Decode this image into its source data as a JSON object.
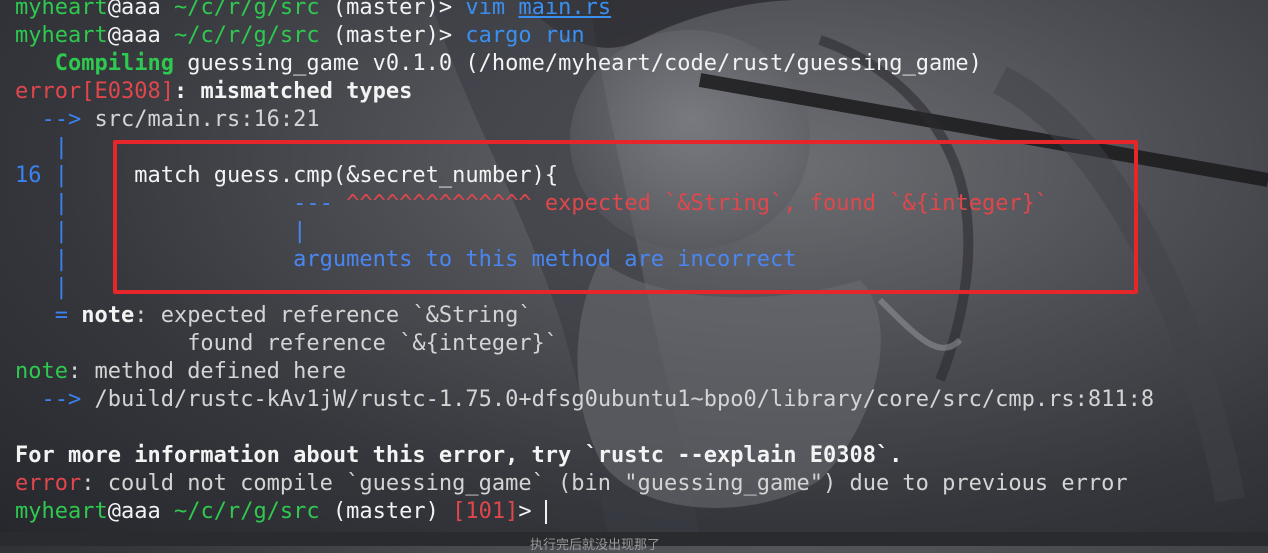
{
  "prompt": {
    "user": "myheart",
    "at": "@",
    "host": "aaa",
    "path": "~/c/r/g/src",
    "branch": "(master)",
    "symbol": ">",
    "exit_code": "[101]"
  },
  "lines": {
    "cmd1": {
      "program": "vim",
      "arg": "main.rs"
    },
    "cmd2": {
      "program": "cargo",
      "arg": "run"
    },
    "compiling": {
      "label": "Compiling",
      "text": "guessing_game v0.1.0 (/home/myheart/code/rust/guessing_game)"
    },
    "error1": {
      "code": "error[E0308]",
      "message": ": mismatched types"
    },
    "arrow1": {
      "arrow": "-->",
      "location": "src/main.rs:16:21"
    },
    "gutter_bar": "|",
    "line16": {
      "number": "16",
      "code": "match guess.cmp(&secret_number){"
    },
    "caret": {
      "dashes": "---",
      "carets": "^^^^^^^^^^^^^^",
      "message": "expected `&String`, found `&{integer}`"
    },
    "pipe": "|",
    "args_note": "arguments to this method are incorrect",
    "note1": {
      "eq": "=",
      "label": "note",
      "text": ": expected reference `&String`"
    },
    "note1b": "found reference `&{integer}`",
    "note2": {
      "label": "note",
      "text": ": method defined here"
    },
    "arrow2": {
      "arrow": "-->",
      "location": "/build/rustc-kAv1jW/rustc-1.75.0+dfsg0ubuntu1~bpo0/library/core/src/cmp.rs:811:8"
    },
    "more_info": "For more information about this error, try `rustc --explain E0308`.",
    "error2": {
      "label": "error",
      "text": ": could not compile `guessing_game` (bin \"guessing_game\") due to previous error"
    }
  },
  "bottom_caption": "执行完后就没出现那了",
  "colors": {
    "green": "#2ec94e",
    "blue": "#3a8ff0",
    "red": "#e0474b",
    "highlight": "#e5262b"
  }
}
